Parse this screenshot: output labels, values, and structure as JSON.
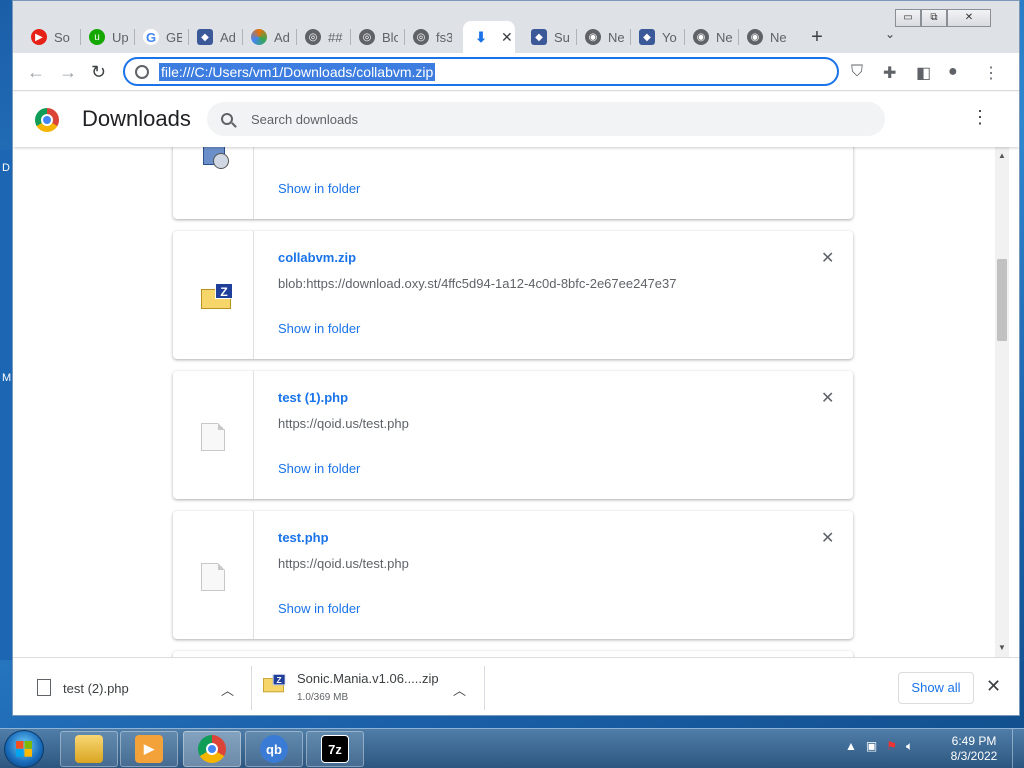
{
  "desktop": {
    "letters": [
      "D",
      "M"
    ]
  },
  "tabs": [
    {
      "label": "So",
      "icon": "youtube-icon",
      "color": "#e62117"
    },
    {
      "label": "Up",
      "icon": "upwork-icon",
      "color": "#14a800"
    },
    {
      "label": "GB",
      "icon": "google-icon",
      "color": "#4285f4"
    },
    {
      "label": "Ad",
      "icon": "shield-icon",
      "color": "#3b5998"
    },
    {
      "label": "Ad",
      "icon": "colorful-icon",
      "color": "#e8710a"
    },
    {
      "label": "##",
      "icon": "globe-icon",
      "color": "#5f6368"
    },
    {
      "label": "Blc",
      "icon": "globe-icon",
      "color": "#5f6368"
    },
    {
      "label": "fs3",
      "icon": "globe-icon",
      "color": "#5f6368"
    },
    {
      "label": "",
      "icon": "download-icon",
      "color": "#1a73e8",
      "active": true
    },
    {
      "label": "Su",
      "icon": "shield-icon",
      "color": "#3b5998"
    },
    {
      "label": "Ne",
      "icon": "chrome-gray-icon",
      "color": "#5f6368"
    },
    {
      "label": "Yo",
      "icon": "shield-icon",
      "color": "#3b5998"
    },
    {
      "label": "Ne",
      "icon": "chrome-gray-icon",
      "color": "#5f6368"
    },
    {
      "label": "Ne",
      "icon": "chrome-gray-icon",
      "color": "#5f6368"
    }
  ],
  "window": {
    "minimize": "▭",
    "maximize": "⧉",
    "close": "✕"
  },
  "toolbar": {
    "url": "file:///C:/Users/vm1/Downloads/collabvm.zip"
  },
  "downloads_page": {
    "title": "Downloads",
    "search_placeholder": "Search downloads"
  },
  "downloads": [
    {
      "name": "",
      "url": "",
      "action": "Show in folder",
      "icon": "installer-icon",
      "partial": true
    },
    {
      "name": "collabvm.zip",
      "url": "blob:https://download.oxy.st/4ffc5d94-1a12-4c0d-8bfc-2e67ee247e37",
      "action": "Show in folder",
      "icon": "zip-icon"
    },
    {
      "name": "test (1).php",
      "url": "https://qoid.us/test.php",
      "action": "Show in folder",
      "icon": "document-icon"
    },
    {
      "name": "test.php",
      "url": "https://qoid.us/test.php",
      "action": "Show in folder",
      "icon": "document-icon"
    }
  ],
  "shelf": {
    "items": [
      {
        "name": "test (2).php",
        "sub": ""
      },
      {
        "name": "Sonic.Mania.v1.06.....zip",
        "sub": "1.0/369 MB"
      }
    ],
    "show_all": "Show all"
  },
  "taskbar": {
    "apps": [
      {
        "icon": "explorer-icon"
      },
      {
        "icon": "media-player-icon"
      },
      {
        "icon": "chrome-icon"
      },
      {
        "icon": "qbittorrent-icon",
        "text": "qb"
      },
      {
        "icon": "7zip-icon",
        "text": "7z"
      }
    ],
    "time": "6:49 PM",
    "date": "8/3/2022"
  }
}
